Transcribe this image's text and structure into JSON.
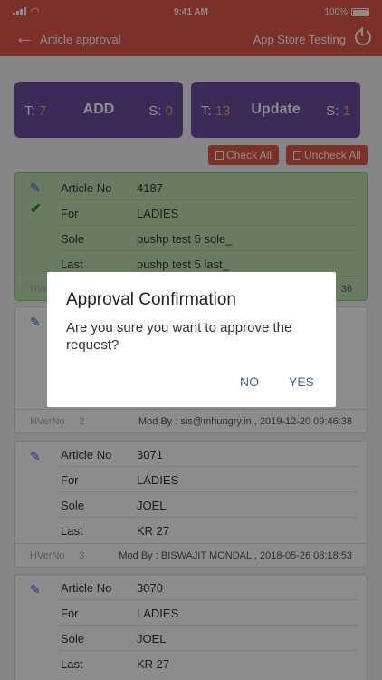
{
  "status_bar": {
    "time": "9:41 AM",
    "battery": "100%"
  },
  "app_bar": {
    "title": "Article approval",
    "right_text": "App Store Testing"
  },
  "counters": {
    "add": {
      "t_label": "T:",
      "t_value": "7",
      "center": "ADD",
      "s_label": "S:",
      "s_value": "0"
    },
    "update": {
      "t_label": "T:",
      "t_value": "13",
      "center": "Update",
      "s_label": "S:",
      "s_value": "1"
    }
  },
  "buttons": {
    "check_all": "Check All",
    "uncheck_all": "Uncheck All"
  },
  "cards": [
    {
      "rows": [
        {
          "k": "Article No",
          "v": "4187"
        },
        {
          "k": "For",
          "v": "LADIES"
        },
        {
          "k": "Sole",
          "v": "pushp test 5 sole_"
        },
        {
          "k": "Last",
          "v": "pushp test 5 last_"
        }
      ],
      "footer": {
        "hv": "HVe",
        "time": "36"
      }
    },
    {
      "footer": {
        "hv": "HVerNo",
        "no": "2",
        "mod": "Mod By :  sis@mhungry.in ,   2019-12-20 09:46:38"
      }
    },
    {
      "rows": [
        {
          "k": "Article No",
          "v": "3071"
        },
        {
          "k": "For",
          "v": "LADIES"
        },
        {
          "k": "Sole",
          "v": "JOEL"
        },
        {
          "k": "Last",
          "v": "KR 27"
        }
      ],
      "footer": {
        "hv": "HVerNo",
        "no": "3",
        "mod": "Mod By :  BISWAJIT MONDAL ,   2018-05-26 08:18:53"
      }
    },
    {
      "rows": [
        {
          "k": "Article No",
          "v": "3070"
        },
        {
          "k": "For",
          "v": "LADIES"
        },
        {
          "k": "Sole",
          "v": "JOEL"
        },
        {
          "k": "Last",
          "v": "KR 27"
        }
      ]
    }
  ],
  "dialog": {
    "title": "Approval Confirmation",
    "message": "Are you sure you want to approve the request?",
    "no": "NO",
    "yes": "YES"
  }
}
